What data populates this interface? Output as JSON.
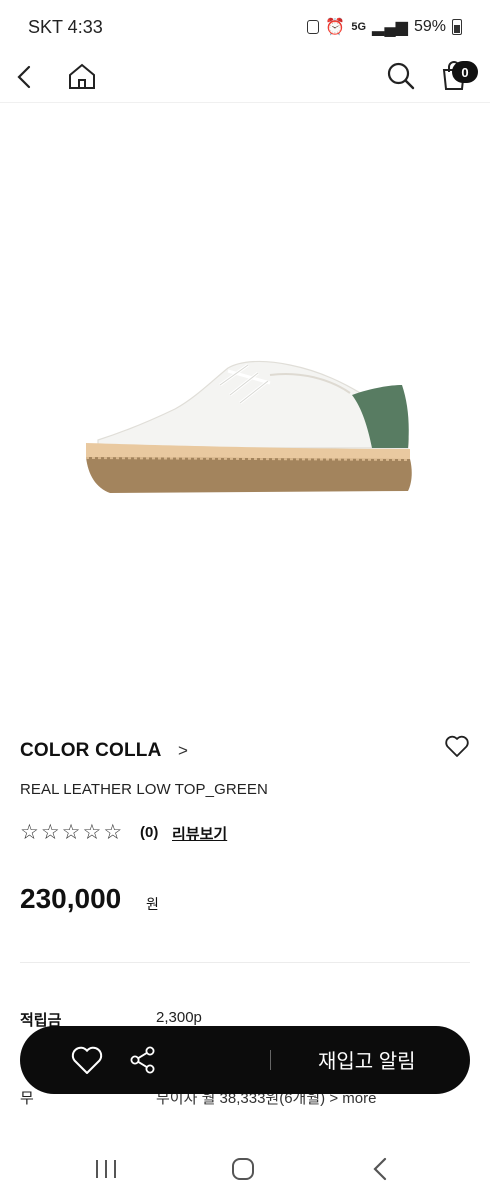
{
  "status_bar": {
    "carrier_time": "SKT 4:33",
    "network": "5G",
    "battery": "59%"
  },
  "header": {
    "cart_count": "0",
    "icons": [
      "back-icon",
      "home-icon",
      "search-icon",
      "cart-icon"
    ]
  },
  "product": {
    "brand": "COLOR COLLA",
    "brand_arrow": ">",
    "name": "REAL LEATHER LOW TOP_GREEN",
    "rating_stars": 0,
    "review_count": "(0)",
    "review_link": "리뷰보기",
    "price": "230,000",
    "currency": "원"
  },
  "details": {
    "points_label": "적립금",
    "points_value": "2,300p",
    "installment_label": "무",
    "installment_text": "무이자 월 38,333원(6개월) > more"
  },
  "action_bar": {
    "restock_label": "재입고 알림",
    "icons": [
      "heart-icon",
      "share-icon"
    ]
  },
  "colors": {
    "action_bar_bg": "#0c0c0c",
    "text_primary": "#111111"
  }
}
